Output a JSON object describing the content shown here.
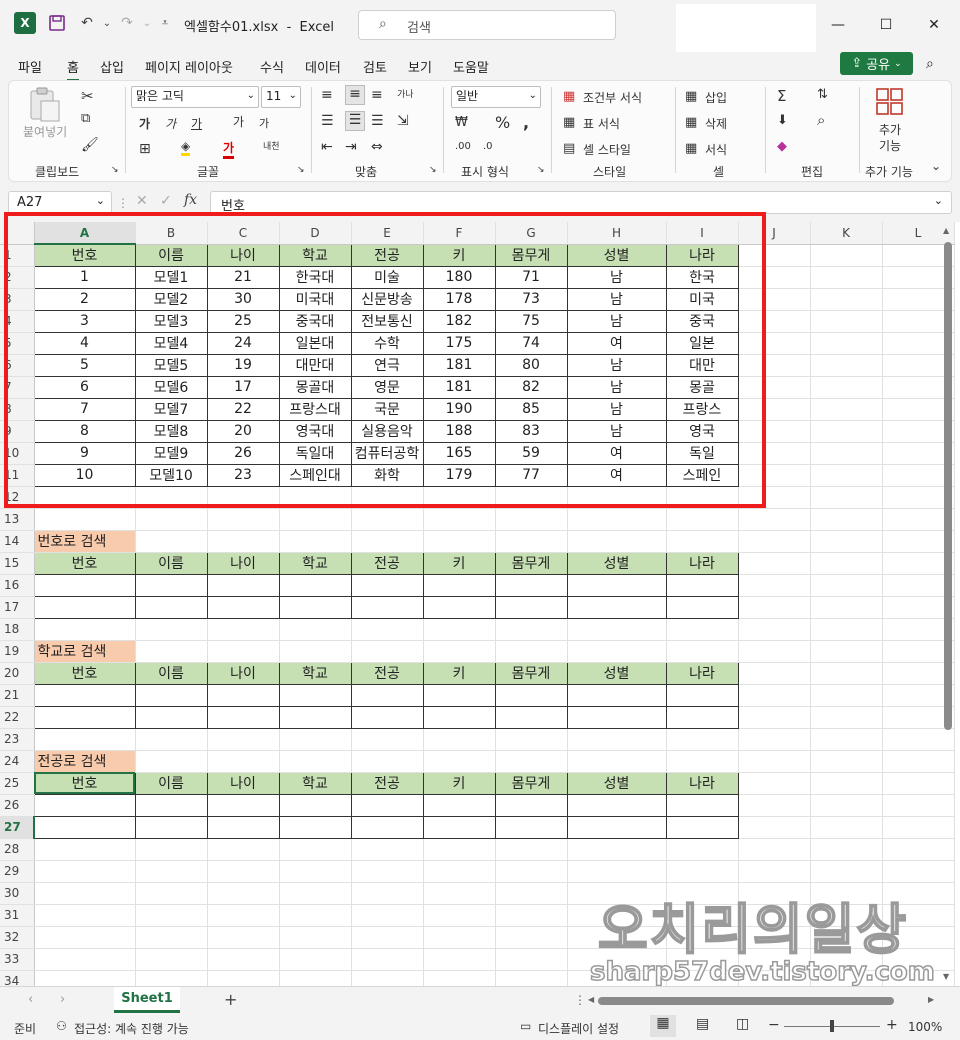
{
  "app": {
    "filename": "엑셀함수01.xlsx",
    "separator": "-",
    "appname": "Excel",
    "search_placeholder": "검색"
  },
  "menu": [
    "파일",
    "홈",
    "삽입",
    "페이지 레이아웃",
    "수식",
    "데이터",
    "검토",
    "보기",
    "도움말"
  ],
  "share_label": "공유",
  "ribbon": {
    "clipboard": {
      "label": "클립보드",
      "paste": "붙여넣기"
    },
    "font": {
      "label": "글꼴",
      "font_name": "맑은 고딕",
      "font_size": "11",
      "bold": "가",
      "italic": "가",
      "underline": "가",
      "grow": "가",
      "shrink": "가",
      "fill": "가",
      "color": "가",
      "phonetic": "내천"
    },
    "align": {
      "label": "맞춤",
      "wrap": "가나"
    },
    "number": {
      "label": "표시 형식",
      "format": "일반"
    },
    "styles": {
      "label": "스타일",
      "cond": "조건부 서식",
      "table": "표 서식",
      "cell": "셀 스타일"
    },
    "cells": {
      "label": "셀",
      "insert": "삽입",
      "delete": "삭제",
      "format": "서식"
    },
    "editing": {
      "label": "편집"
    },
    "addins": {
      "label": "추가 기능",
      "btn1": "추가",
      "btn2": "기능"
    }
  },
  "formula": {
    "cell_ref": "A27",
    "fx": "fx",
    "content": "번호"
  },
  "columns": [
    "A",
    "B",
    "C",
    "D",
    "E",
    "F",
    "G",
    "H",
    "I",
    "J",
    "K",
    "L"
  ],
  "headers": [
    "번호",
    "이름",
    "나이",
    "학교",
    "전공",
    "키",
    "몸무게",
    "성별",
    "나라"
  ],
  "rows": [
    [
      "1",
      "모델1",
      "21",
      "한국대",
      "미술",
      "180",
      "71",
      "남",
      "한국"
    ],
    [
      "2",
      "모델2",
      "30",
      "미국대",
      "신문방송",
      "178",
      "73",
      "남",
      "미국"
    ],
    [
      "3",
      "모델3",
      "25",
      "중국대",
      "전보통신",
      "182",
      "75",
      "남",
      "중국"
    ],
    [
      "4",
      "모델4",
      "24",
      "일본대",
      "수학",
      "175",
      "74",
      "여",
      "일본"
    ],
    [
      "5",
      "모델5",
      "19",
      "대만대",
      "연극",
      "181",
      "80",
      "남",
      "대만"
    ],
    [
      "6",
      "모델6",
      "17",
      "몽골대",
      "영문",
      "181",
      "82",
      "남",
      "몽골"
    ],
    [
      "7",
      "모델7",
      "22",
      "프랑스대",
      "국문",
      "190",
      "85",
      "남",
      "프랑스"
    ],
    [
      "8",
      "모델8",
      "20",
      "영국대",
      "실용음악",
      "188",
      "83",
      "남",
      "영국"
    ],
    [
      "9",
      "모델9",
      "26",
      "독일대",
      "컴퓨터공학",
      "165",
      "59",
      "여",
      "독일"
    ],
    [
      "10",
      "모델10",
      "23",
      "스페인대",
      "화학",
      "179",
      "77",
      "여",
      "스페인"
    ]
  ],
  "search_sections": [
    {
      "label": "번호로 검색"
    },
    {
      "label": "학교로 검색"
    },
    {
      "label": "전공로 검색"
    }
  ],
  "sheet_tab": "Sheet1",
  "add_sheet": "+",
  "status": {
    "ready": "준비",
    "accessibility": "접근성: 계속 진행 가능",
    "display": "디스플레이 설정",
    "zoom": "100%"
  },
  "watermark": {
    "title": "오치리의일상",
    "url": "sharp57dev.tistory.com"
  },
  "colors": {
    "header_fill": "#c6e0b4",
    "label_fill": "#f8cbad",
    "accent": "#217346",
    "highlight": "#ee1c1c"
  }
}
